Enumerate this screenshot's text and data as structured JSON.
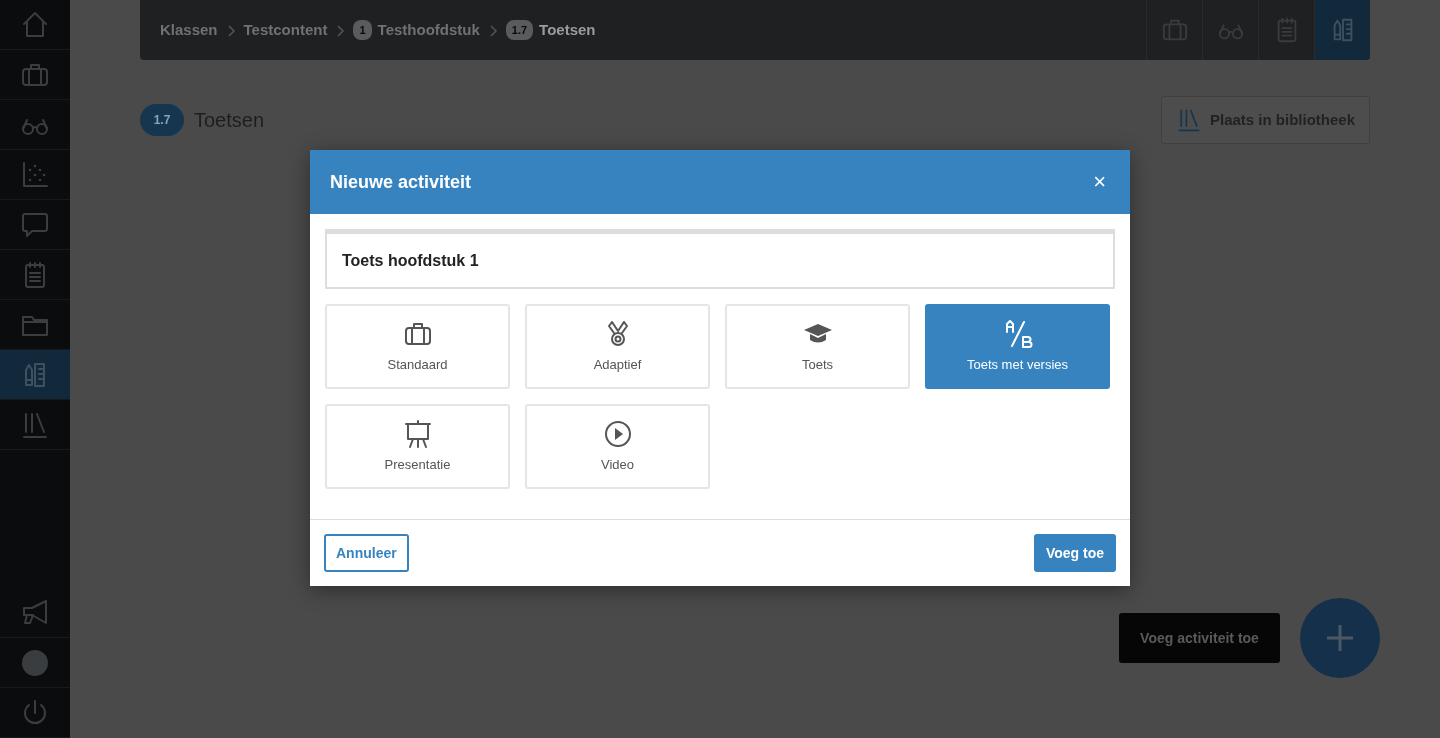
{
  "sidebar": {
    "items": [
      {
        "selected": false
      },
      {
        "selected": false
      },
      {
        "selected": false
      },
      {
        "selected": false
      },
      {
        "selected": false
      },
      {
        "selected": false
      },
      {
        "selected": false
      },
      {
        "selected": true
      },
      {
        "selected": false
      }
    ]
  },
  "breadcrumb": [
    {
      "text": "Klassen",
      "current": false
    },
    {
      "text": "Testcontent",
      "current": false
    },
    {
      "badge": "1",
      "text": "Testhoofdstuk",
      "current": false
    },
    {
      "badge": "1.7",
      "text": "Toetsen",
      "current": true
    }
  ],
  "view_tabs": [
    {
      "selected": false
    },
    {
      "selected": false
    },
    {
      "selected": false
    },
    {
      "selected": true
    }
  ],
  "page": {
    "badge": "1.7",
    "title": "Toetsen",
    "library_button": "Plaats in bibliotheek"
  },
  "modal": {
    "title": "Nieuwe activiteit",
    "close": "×",
    "name_value": "Toets hoofdstuk 1",
    "activity_types": [
      {
        "label": "Standaard",
        "selected": false
      },
      {
        "label": "Adaptief",
        "selected": false
      },
      {
        "label": "Toets",
        "selected": false
      },
      {
        "label": "Toets met versies",
        "selected": true
      },
      {
        "label": "Presentatie",
        "selected": false
      },
      {
        "label": "Video",
        "selected": false
      }
    ],
    "cancel": "Annuleer",
    "confirm": "Voeg toe"
  },
  "fab": {
    "tooltip": "Voeg activiteit toe"
  }
}
